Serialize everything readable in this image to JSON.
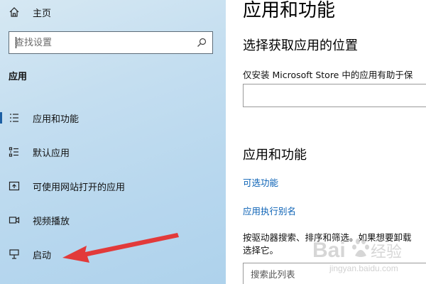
{
  "sidebar": {
    "home_label": "主页",
    "search_placeholder": "查找设置",
    "section_title": "应用",
    "items": [
      {
        "label": "应用和功能",
        "icon": "apps-features-icon",
        "selected": true
      },
      {
        "label": "默认应用",
        "icon": "default-apps-icon"
      },
      {
        "label": "可使用网站打开的应用",
        "icon": "apps-for-websites-icon"
      },
      {
        "label": "视频播放",
        "icon": "video-playback-icon"
      },
      {
        "label": "启动",
        "icon": "startup-icon"
      }
    ],
    "icons": {
      "home": "home-icon",
      "search": "search-icon"
    }
  },
  "main": {
    "title": "应用和功能",
    "install_section_title": "选择获取应用的位置",
    "install_description": "仅安装 Microsoft Store 中的应用有助于保",
    "apps_section_title": "应用和功能",
    "links": [
      "可选功能",
      "应用执行别名"
    ],
    "paragraph_line1": "按驱动器搜索、排序和筛选。如果想要卸载",
    "paragraph_line2": "选择它。",
    "list_search_placeholder": "搜索此列表"
  },
  "watermark": {
    "text": "Baidu经验",
    "url_text": "jingyan.baidu.com"
  },
  "colors": {
    "sidebar_bg": "#c4def0",
    "accent": "#1d5fa3",
    "link": "#0a61b5",
    "arrow": "#e23a3a"
  }
}
